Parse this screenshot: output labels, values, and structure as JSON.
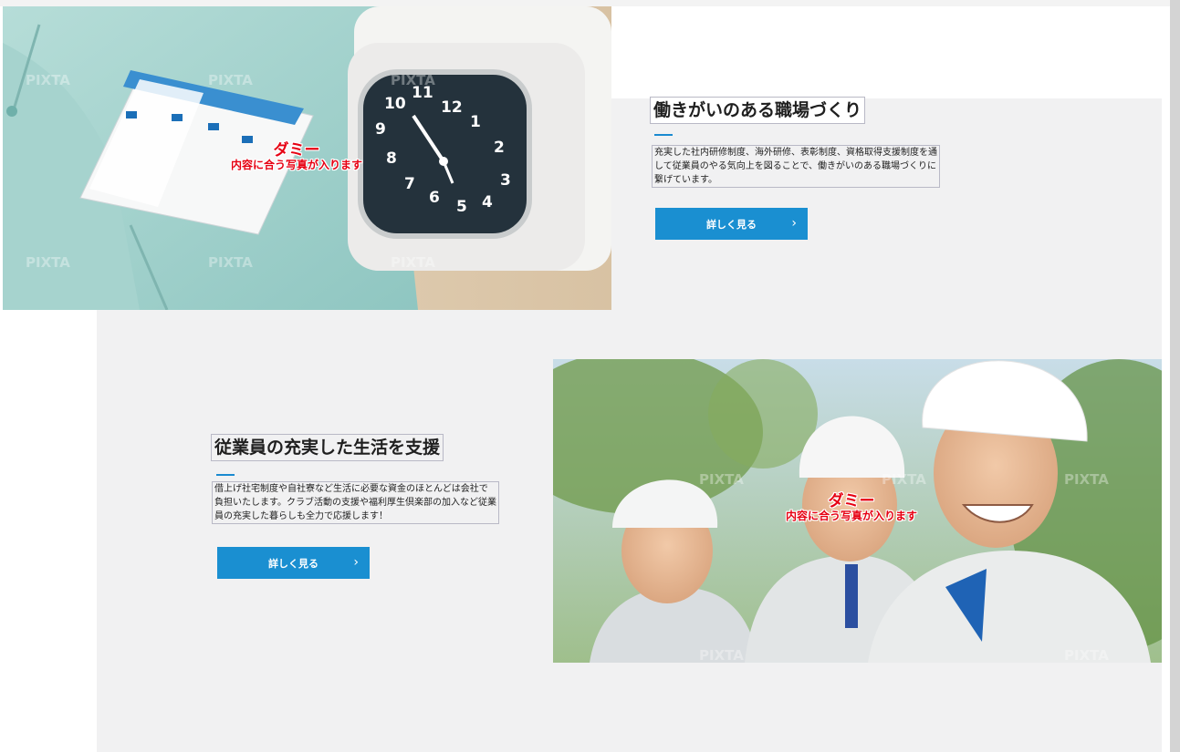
{
  "section1": {
    "title": "働きがいのある職場づくり",
    "description": "充実した社内研修制度、海外研修、表彰制度、資格取得支援制度を通して従業員のやる気向上を図ることで、働きがいのある職場づくりに繋げています。",
    "button_label": "詳しく見る",
    "button_icon": "chevron-right-icon",
    "image_overlay_main": "ダミー",
    "image_overlay_sub": "内容に合う写真が入ります",
    "watermark": "PIXTA"
  },
  "section2": {
    "title": "従業員の充実した生活を支援",
    "description": "借上げ社宅制度や自社寮など生活に必要な資金のほとんどは会社で負担いたします。クラブ活動の支援や福利厚生倶楽部の加入など従業員の充実した暮らしも全力で応援します！",
    "button_label": "詳しく見る",
    "button_icon": "chevron-right-icon",
    "image_overlay_main": "ダミー",
    "image_overlay_sub": "内容に合う写真が入ります",
    "watermark": "PIXTA"
  },
  "colors": {
    "accent": "#1a8fd1",
    "band": "#f1f1f2",
    "dummy_text": "#e60012"
  }
}
